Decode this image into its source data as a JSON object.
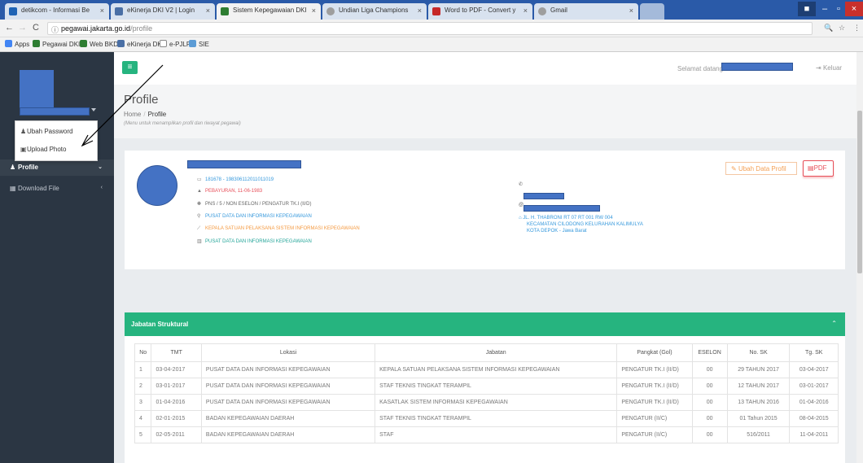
{
  "browser": {
    "tabs": [
      {
        "label": "detikcom - Informasi Be",
        "color": "#1e63b5"
      },
      {
        "label": "eKinerja DKI V2 | Login",
        "color": "#4a6fa5"
      },
      {
        "label": "Sistem Kepegawaian DKI",
        "color": "#2e7d32"
      },
      {
        "label": "Undian Liga Champions",
        "color": "#9e9e9e"
      },
      {
        "label": "Word to PDF - Convert y",
        "color": "#c62828"
      },
      {
        "label": "Gmail",
        "color": "#9e9e9e"
      }
    ],
    "url_host": "pegawai.jakarta.go.id",
    "url_path": "/profile",
    "bookmarks": [
      "Apps",
      "Pegawai DKI",
      "Web BKD",
      "eKinerja DKI",
      "e-PJLP",
      "SIE"
    ]
  },
  "sidebar": {
    "dropdown": [
      "Ubah Password",
      "Upload Photo"
    ],
    "menu": [
      {
        "label": "Profile",
        "active": true
      },
      {
        "label": "Download File",
        "active": false
      }
    ]
  },
  "topbar": {
    "welcome": "Selamat datang",
    "logout": "Keluar"
  },
  "page": {
    "title": "Profile",
    "breadcrumb_home": "Home",
    "breadcrumb_current": "Profile",
    "description": "(Menu untuk menampilkan profil dan riwayat pegawai)"
  },
  "profile": {
    "nip": "181678 - 198306112011011019",
    "birth": "PEBAYURAN, 11-06-1983",
    "status": "PNS / 5 / NON ESELON / PENGATUR TK.I (II/D)",
    "unit": "PUSAT DATA DAN INFORMASI KEPEGAWAIAN",
    "position": "KEPALA SATUAN PELAKSANA SISTEM INFORMASI KEPEGAWAIAN",
    "work_unit": "PUSAT DATA DAN INFORMASI KEPEGAWAIAN",
    "address_1": "JL. H. THABRONI RT 07 RT 001 RW 004",
    "address_2": "KECAMATAN CILODONG KELURAHAN KALIMULYA",
    "address_3": "KOTA DEPOK - Jawa Barat",
    "btn_edit": "Ubah Data Profil",
    "btn_pdf": "PDF"
  },
  "jabatan": {
    "title": "Jabatan Struktural",
    "headers": [
      "No",
      "TMT",
      "Lokasi",
      "Jabatan",
      "Pangkat (Gol)",
      "ESELON",
      "No. SK",
      "Tg. SK"
    ],
    "rows": [
      [
        "1",
        "03-04-2017",
        "PUSAT DATA DAN INFORMASI KEPEGAWAIAN",
        "KEPALA SATUAN PELAKSANA SISTEM INFORMASI KEPEGAWAIAN",
        "PENGATUR TK.I (II/D)",
        "00",
        "29 TAHUN 2017",
        "03-04-2017"
      ],
      [
        "2",
        "03-01-2017",
        "PUSAT DATA DAN INFORMASI KEPEGAWAIAN",
        "STAF TEKNIS TINGKAT TERAMPIL",
        "PENGATUR TK.I (II/D)",
        "00",
        "12 TAHUN 2017",
        "03-01-2017"
      ],
      [
        "3",
        "01-04-2016",
        "PUSAT DATA DAN INFORMASI KEPEGAWAIAN",
        "KASATLAK SISTEM INFORMASI KEPEGAWAIAN",
        "PENGATUR TK.I (II/D)",
        "00",
        "13 TAHUN 2016",
        "01-04-2016"
      ],
      [
        "4",
        "02-01-2015",
        "BADAN KEPEGAWAIAN DAERAH",
        "STAF TEKNIS TINGKAT TERAMPIL",
        "PENGATUR (II/C)",
        "00",
        "01 Tahun 2015",
        "08-04-2015"
      ],
      [
        "5",
        "02-05-2011",
        "BADAN KEPEGAWAIAN DAERAH",
        "STAF",
        "PENGATUR (II/C)",
        "00",
        "516/2011",
        "11-04-2011"
      ]
    ]
  }
}
